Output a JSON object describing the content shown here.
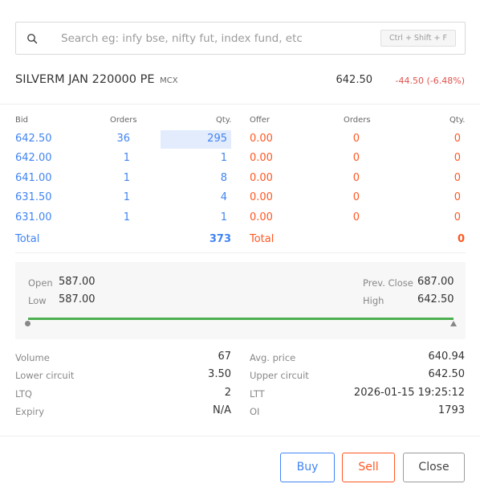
{
  "search": {
    "placeholder": "Search eg: infy bse, nifty fut, index fund, etc",
    "shortcut": "Ctrl + Shift + F",
    "icon": "search-icon"
  },
  "instrument": {
    "symbol": "SILVERM JAN 220000 PE",
    "exchange": "MCX",
    "ltp": "642.50",
    "change": "-44.50 (-6.48%)"
  },
  "depth": {
    "headers": {
      "bid": "Bid",
      "bid_orders": "Orders",
      "bid_qty": "Qty.",
      "offer": "Offer",
      "offer_orders": "Orders",
      "offer_qty": "Qty."
    },
    "bids": [
      {
        "price": "642.50",
        "orders": "36",
        "qty": "295"
      },
      {
        "price": "642.00",
        "orders": "1",
        "qty": "1"
      },
      {
        "price": "641.00",
        "orders": "1",
        "qty": "8"
      },
      {
        "price": "631.50",
        "orders": "1",
        "qty": "4"
      },
      {
        "price": "631.00",
        "orders": "1",
        "qty": "1"
      }
    ],
    "offers": [
      {
        "price": "0.00",
        "orders": "0",
        "qty": "0"
      },
      {
        "price": "0.00",
        "orders": "0",
        "qty": "0"
      },
      {
        "price": "0.00",
        "orders": "0",
        "qty": "0"
      },
      {
        "price": "0.00",
        "orders": "0",
        "qty": "0"
      },
      {
        "price": "0.00",
        "orders": "0",
        "qty": "0"
      }
    ],
    "total_label": "Total",
    "bid_total": "373",
    "offer_total": "0"
  },
  "ohlc": {
    "open_label": "Open",
    "open": "587.00",
    "low_label": "Low",
    "low": "587.00",
    "prev_close_label": "Prev. Close",
    "prev_close": "687.00",
    "high_label": "High",
    "high": "642.50"
  },
  "stats": {
    "volume_label": "Volume",
    "volume": "67",
    "lower_circuit_label": "Lower circuit",
    "lower_circuit": "3.50",
    "ltq_label": "LTQ",
    "ltq": "2",
    "expiry_label": "Expiry",
    "expiry": "N/A",
    "avg_price_label": "Avg. price",
    "avg_price": "640.94",
    "upper_circuit_label": "Upper circuit",
    "upper_circuit": "642.50",
    "ltt_label": "LTT",
    "ltt": "2026-01-15 19:25:12",
    "oi_label": "OI",
    "oi": "1793"
  },
  "buttons": {
    "buy": "Buy",
    "sell": "Sell",
    "close": "Close"
  },
  "colors": {
    "bid": "#4184f3",
    "offer": "#ff5722",
    "negative": "#df514c",
    "range": "#4caf50"
  }
}
